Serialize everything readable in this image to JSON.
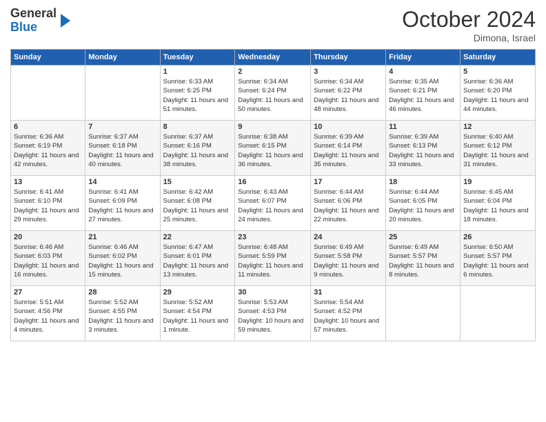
{
  "logo": {
    "general": "General",
    "blue": "Blue"
  },
  "header": {
    "month": "October 2024",
    "location": "Dimona, Israel"
  },
  "weekdays": [
    "Sunday",
    "Monday",
    "Tuesday",
    "Wednesday",
    "Thursday",
    "Friday",
    "Saturday"
  ],
  "weeks": [
    [
      {
        "day": "",
        "sunrise": "",
        "sunset": "",
        "daylight": ""
      },
      {
        "day": "",
        "sunrise": "",
        "sunset": "",
        "daylight": ""
      },
      {
        "day": "1",
        "sunrise": "Sunrise: 6:33 AM",
        "sunset": "Sunset: 6:25 PM",
        "daylight": "Daylight: 11 hours and 51 minutes."
      },
      {
        "day": "2",
        "sunrise": "Sunrise: 6:34 AM",
        "sunset": "Sunset: 6:24 PM",
        "daylight": "Daylight: 11 hours and 50 minutes."
      },
      {
        "day": "3",
        "sunrise": "Sunrise: 6:34 AM",
        "sunset": "Sunset: 6:22 PM",
        "daylight": "Daylight: 11 hours and 48 minutes."
      },
      {
        "day": "4",
        "sunrise": "Sunrise: 6:35 AM",
        "sunset": "Sunset: 6:21 PM",
        "daylight": "Daylight: 11 hours and 46 minutes."
      },
      {
        "day": "5",
        "sunrise": "Sunrise: 6:36 AM",
        "sunset": "Sunset: 6:20 PM",
        "daylight": "Daylight: 11 hours and 44 minutes."
      }
    ],
    [
      {
        "day": "6",
        "sunrise": "Sunrise: 6:36 AM",
        "sunset": "Sunset: 6:19 PM",
        "daylight": "Daylight: 11 hours and 42 minutes."
      },
      {
        "day": "7",
        "sunrise": "Sunrise: 6:37 AM",
        "sunset": "Sunset: 6:18 PM",
        "daylight": "Daylight: 11 hours and 40 minutes."
      },
      {
        "day": "8",
        "sunrise": "Sunrise: 6:37 AM",
        "sunset": "Sunset: 6:16 PM",
        "daylight": "Daylight: 11 hours and 38 minutes."
      },
      {
        "day": "9",
        "sunrise": "Sunrise: 6:38 AM",
        "sunset": "Sunset: 6:15 PM",
        "daylight": "Daylight: 11 hours and 36 minutes."
      },
      {
        "day": "10",
        "sunrise": "Sunrise: 6:39 AM",
        "sunset": "Sunset: 6:14 PM",
        "daylight": "Daylight: 11 hours and 35 minutes."
      },
      {
        "day": "11",
        "sunrise": "Sunrise: 6:39 AM",
        "sunset": "Sunset: 6:13 PM",
        "daylight": "Daylight: 11 hours and 33 minutes."
      },
      {
        "day": "12",
        "sunrise": "Sunrise: 6:40 AM",
        "sunset": "Sunset: 6:12 PM",
        "daylight": "Daylight: 11 hours and 31 minutes."
      }
    ],
    [
      {
        "day": "13",
        "sunrise": "Sunrise: 6:41 AM",
        "sunset": "Sunset: 6:10 PM",
        "daylight": "Daylight: 11 hours and 29 minutes."
      },
      {
        "day": "14",
        "sunrise": "Sunrise: 6:41 AM",
        "sunset": "Sunset: 6:09 PM",
        "daylight": "Daylight: 11 hours and 27 minutes."
      },
      {
        "day": "15",
        "sunrise": "Sunrise: 6:42 AM",
        "sunset": "Sunset: 6:08 PM",
        "daylight": "Daylight: 11 hours and 25 minutes."
      },
      {
        "day": "16",
        "sunrise": "Sunrise: 6:43 AM",
        "sunset": "Sunset: 6:07 PM",
        "daylight": "Daylight: 11 hours and 24 minutes."
      },
      {
        "day": "17",
        "sunrise": "Sunrise: 6:44 AM",
        "sunset": "Sunset: 6:06 PM",
        "daylight": "Daylight: 11 hours and 22 minutes."
      },
      {
        "day": "18",
        "sunrise": "Sunrise: 6:44 AM",
        "sunset": "Sunset: 6:05 PM",
        "daylight": "Daylight: 11 hours and 20 minutes."
      },
      {
        "day": "19",
        "sunrise": "Sunrise: 6:45 AM",
        "sunset": "Sunset: 6:04 PM",
        "daylight": "Daylight: 11 hours and 18 minutes."
      }
    ],
    [
      {
        "day": "20",
        "sunrise": "Sunrise: 6:46 AM",
        "sunset": "Sunset: 6:03 PM",
        "daylight": "Daylight: 11 hours and 16 minutes."
      },
      {
        "day": "21",
        "sunrise": "Sunrise: 6:46 AM",
        "sunset": "Sunset: 6:02 PM",
        "daylight": "Daylight: 11 hours and 15 minutes."
      },
      {
        "day": "22",
        "sunrise": "Sunrise: 6:47 AM",
        "sunset": "Sunset: 6:01 PM",
        "daylight": "Daylight: 11 hours and 13 minutes."
      },
      {
        "day": "23",
        "sunrise": "Sunrise: 6:48 AM",
        "sunset": "Sunset: 5:59 PM",
        "daylight": "Daylight: 11 hours and 11 minutes."
      },
      {
        "day": "24",
        "sunrise": "Sunrise: 6:49 AM",
        "sunset": "Sunset: 5:58 PM",
        "daylight": "Daylight: 11 hours and 9 minutes."
      },
      {
        "day": "25",
        "sunrise": "Sunrise: 6:49 AM",
        "sunset": "Sunset: 5:57 PM",
        "daylight": "Daylight: 11 hours and 8 minutes."
      },
      {
        "day": "26",
        "sunrise": "Sunrise: 6:50 AM",
        "sunset": "Sunset: 5:57 PM",
        "daylight": "Daylight: 11 hours and 6 minutes."
      }
    ],
    [
      {
        "day": "27",
        "sunrise": "Sunrise: 5:51 AM",
        "sunset": "Sunset: 4:56 PM",
        "daylight": "Daylight: 11 hours and 4 minutes."
      },
      {
        "day": "28",
        "sunrise": "Sunrise: 5:52 AM",
        "sunset": "Sunset: 4:55 PM",
        "daylight": "Daylight: 11 hours and 3 minutes."
      },
      {
        "day": "29",
        "sunrise": "Sunrise: 5:52 AM",
        "sunset": "Sunset: 4:54 PM",
        "daylight": "Daylight: 11 hours and 1 minute."
      },
      {
        "day": "30",
        "sunrise": "Sunrise: 5:53 AM",
        "sunset": "Sunset: 4:53 PM",
        "daylight": "Daylight: 10 hours and 59 minutes."
      },
      {
        "day": "31",
        "sunrise": "Sunrise: 5:54 AM",
        "sunset": "Sunset: 4:52 PM",
        "daylight": "Daylight: 10 hours and 57 minutes."
      },
      {
        "day": "",
        "sunrise": "",
        "sunset": "",
        "daylight": ""
      },
      {
        "day": "",
        "sunrise": "",
        "sunset": "",
        "daylight": ""
      }
    ]
  ]
}
